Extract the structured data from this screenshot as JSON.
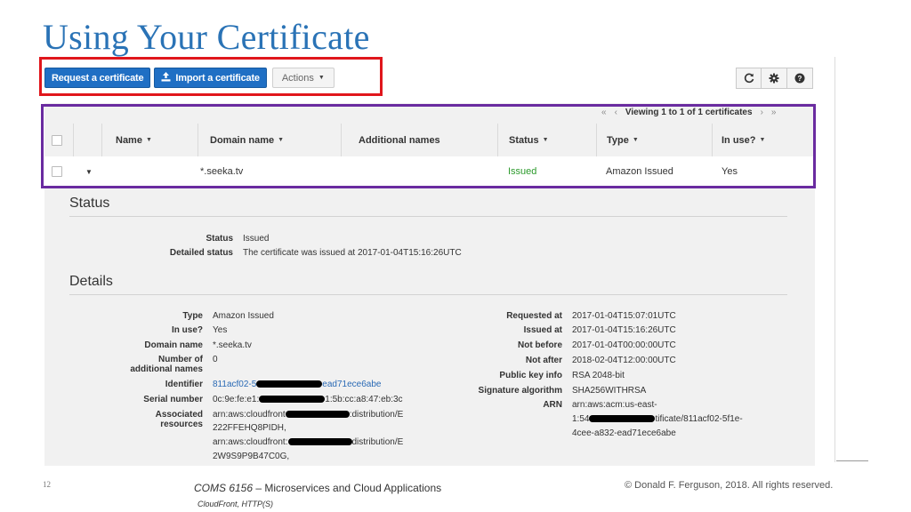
{
  "slide": {
    "title": "Using Your Certificate",
    "number": "12",
    "course_code": "COMS 6156",
    "course_sep": " – ",
    "course_name": "Microservices and Cloud Applications",
    "subtitle": "CloudFront, HTTP(S)",
    "copyright": "© Donald F. Ferguson, 2018. All rights reserved."
  },
  "toolbar": {
    "request_label": "Request a certificate",
    "import_label": "Import a certificate",
    "actions_label": "Actions",
    "icons": [
      "refresh-icon",
      "gear-icon",
      "help-icon"
    ]
  },
  "pager": {
    "text": "Viewing 1 to 1 of 1 certificates"
  },
  "table": {
    "columns": [
      "Name",
      "Domain name",
      "Additional names",
      "Status",
      "Type",
      "In use?"
    ],
    "row": {
      "name": "",
      "domain": "*.seeka.tv",
      "additional": "",
      "status": "Issued",
      "type": "Amazon Issued",
      "in_use": "Yes"
    }
  },
  "status_section": {
    "heading": "Status",
    "status_label": "Status",
    "status_value": "Issued",
    "detailed_label": "Detailed status",
    "detailed_value": "The certificate was issued at 2017-01-04T15:16:26UTC"
  },
  "details_section": {
    "heading": "Details",
    "left": {
      "type_label": "Type",
      "type_value": "Amazon Issued",
      "inuse_label": "In use?",
      "inuse_value": "Yes",
      "domain_label": "Domain name",
      "domain_value": "*.seeka.tv",
      "addl_label_1": "Number of",
      "addl_label_2": "additional names",
      "addl_value": "0",
      "identifier_label": "Identifier",
      "identifier_start": "811acf02-5",
      "identifier_end": "ead71ece6abe",
      "serial_label": "Serial number",
      "serial_start": "0c:9e:fe:e1:",
      "serial_end": "1:5b:cc:a8:47:eb:3c",
      "assoc_label_1": "Associated",
      "assoc_label_2": "resources",
      "assoc1_start": "arn:aws:cloudfront",
      "assoc1_end": ":distribution/E",
      "assoc1_line2": "222FFEHQ8PIDH,",
      "assoc2_start": "arn:aws:cloudfront:",
      "assoc2_end": "distribution/E",
      "assoc2_line2": "2W9S9P9B47C0G,"
    },
    "right": {
      "requested_label": "Requested at",
      "requested_value": "2017-01-04T15:07:01UTC",
      "issued_label": "Issued at",
      "issued_value": "2017-01-04T15:16:26UTC",
      "notbefore_label": "Not before",
      "notbefore_value": "2017-01-04T00:00:00UTC",
      "notafter_label": "Not after",
      "notafter_value": "2018-02-04T12:00:00UTC",
      "pubkey_label": "Public key info",
      "pubkey_value": "RSA 2048-bit",
      "sigalg_label": "Signature algorithm",
      "sigalg_value": "SHA256WITHRSA",
      "arn_label": "ARN",
      "arn_line1": "arn:aws:acm:us-east-",
      "arn_line2_start": "1:54",
      "arn_line2_end": "tificate/811acf02-5f1e-",
      "arn_line3": "4cee-a832-ead71ece6abe"
    }
  },
  "colors": {
    "title_blue": "#2a73b6",
    "primary_button": "#1f6fc4",
    "highlight_red": "#e0161c",
    "highlight_purple": "#6a2ba0",
    "status_green": "#2b9a2b"
  }
}
